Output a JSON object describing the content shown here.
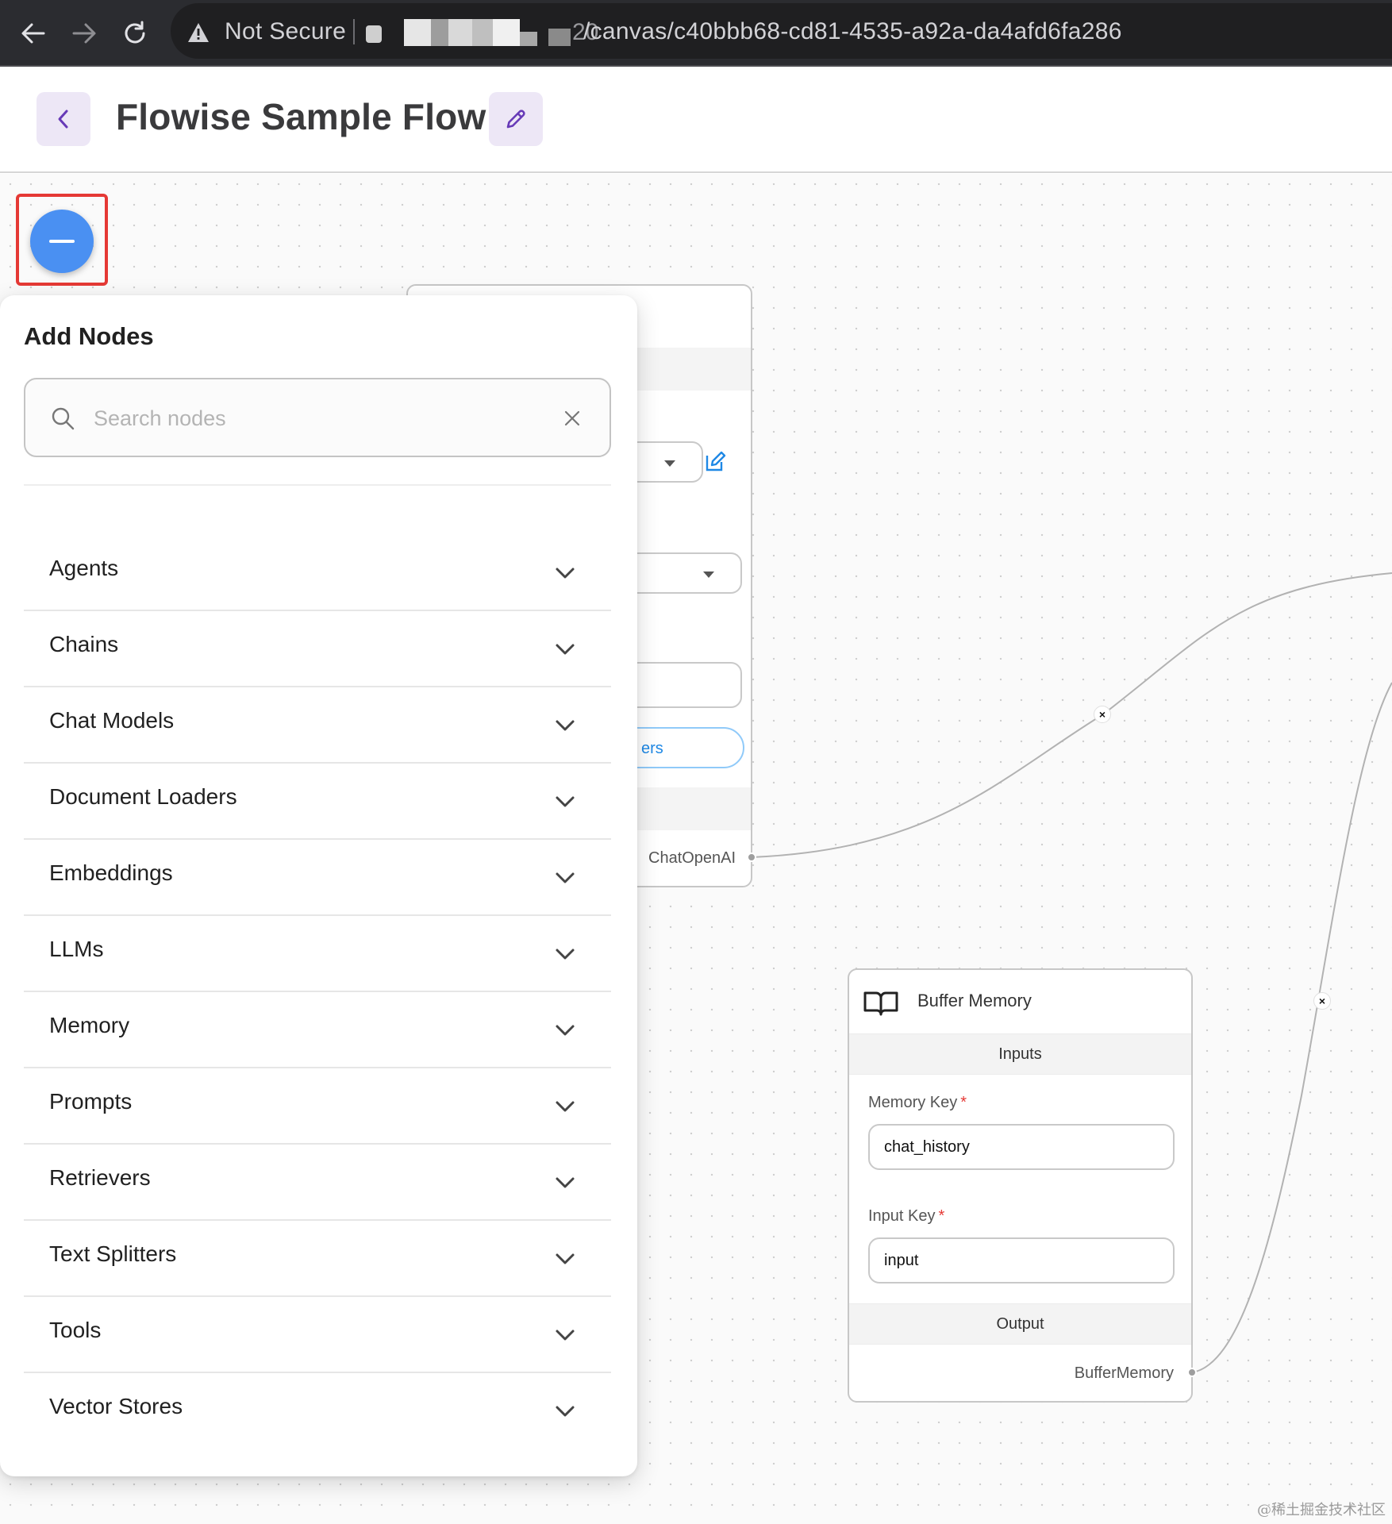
{
  "browser": {
    "security_label": "Not Secure",
    "url_visible": "/canvas/c40bbb68-cd81-4535-a92a-da4afd6fa286",
    "url_prefix_fragment": "20",
    "icons": [
      "back-arrow-icon",
      "forward-arrow-icon",
      "reload-icon",
      "warning-icon"
    ]
  },
  "header": {
    "title": "Flowise Sample Flow",
    "icons": [
      "chevron-left-icon",
      "pencil-icon"
    ],
    "accent_color": "#ede7f6",
    "icon_color": "#673ab7"
  },
  "fab": {
    "icon": "minus-icon",
    "color": "#4a90f2",
    "highlight_color": "#e53935"
  },
  "add_nodes": {
    "title": "Add Nodes",
    "search": {
      "placeholder": "Search nodes",
      "value": ""
    },
    "categories": [
      {
        "label": "Agents"
      },
      {
        "label": "Chains"
      },
      {
        "label": "Chat Models"
      },
      {
        "label": "Document Loaders"
      },
      {
        "label": "Embeddings"
      },
      {
        "label": "LLMs"
      },
      {
        "label": "Memory"
      },
      {
        "label": "Prompts"
      },
      {
        "label": "Retrievers"
      },
      {
        "label": "Text Splitters"
      },
      {
        "label": "Tools"
      },
      {
        "label": "Vector Stores"
      }
    ]
  },
  "chat_node": {
    "output_label": "ChatOpenAI",
    "params_button_fragment": "ers",
    "edit_icon_color": "#1e88e5"
  },
  "buffer_node": {
    "name": "Buffer Memory",
    "icon": "book-icon",
    "inputs_label": "Inputs",
    "memory_key_label": "Memory Key",
    "memory_key_value": "chat_history",
    "input_key_label": "Input Key",
    "input_key_value": "input",
    "required_mark": "*",
    "output_section_label": "Output",
    "output_label": "BufferMemory"
  },
  "edge_delete_label": "×",
  "watermark": "@稀土掘金技术社区"
}
